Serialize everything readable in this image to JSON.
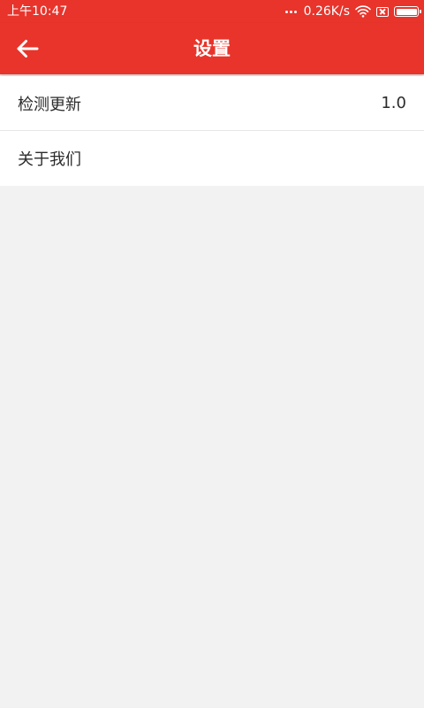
{
  "status_bar": {
    "time": "上午10:47",
    "net_speed": "0.26K/s",
    "icons": [
      "more-dots-icon",
      "wifi-icon",
      "no-sim-icon",
      "battery-icon"
    ],
    "battery_level": 1.0
  },
  "app_bar": {
    "title": "设置",
    "back_icon": "arrow-left-icon",
    "background_color": "#e8342b"
  },
  "settings": {
    "items": [
      {
        "label": "检测更新",
        "value": "1.0"
      },
      {
        "label": "关于我们",
        "value": ""
      }
    ]
  }
}
